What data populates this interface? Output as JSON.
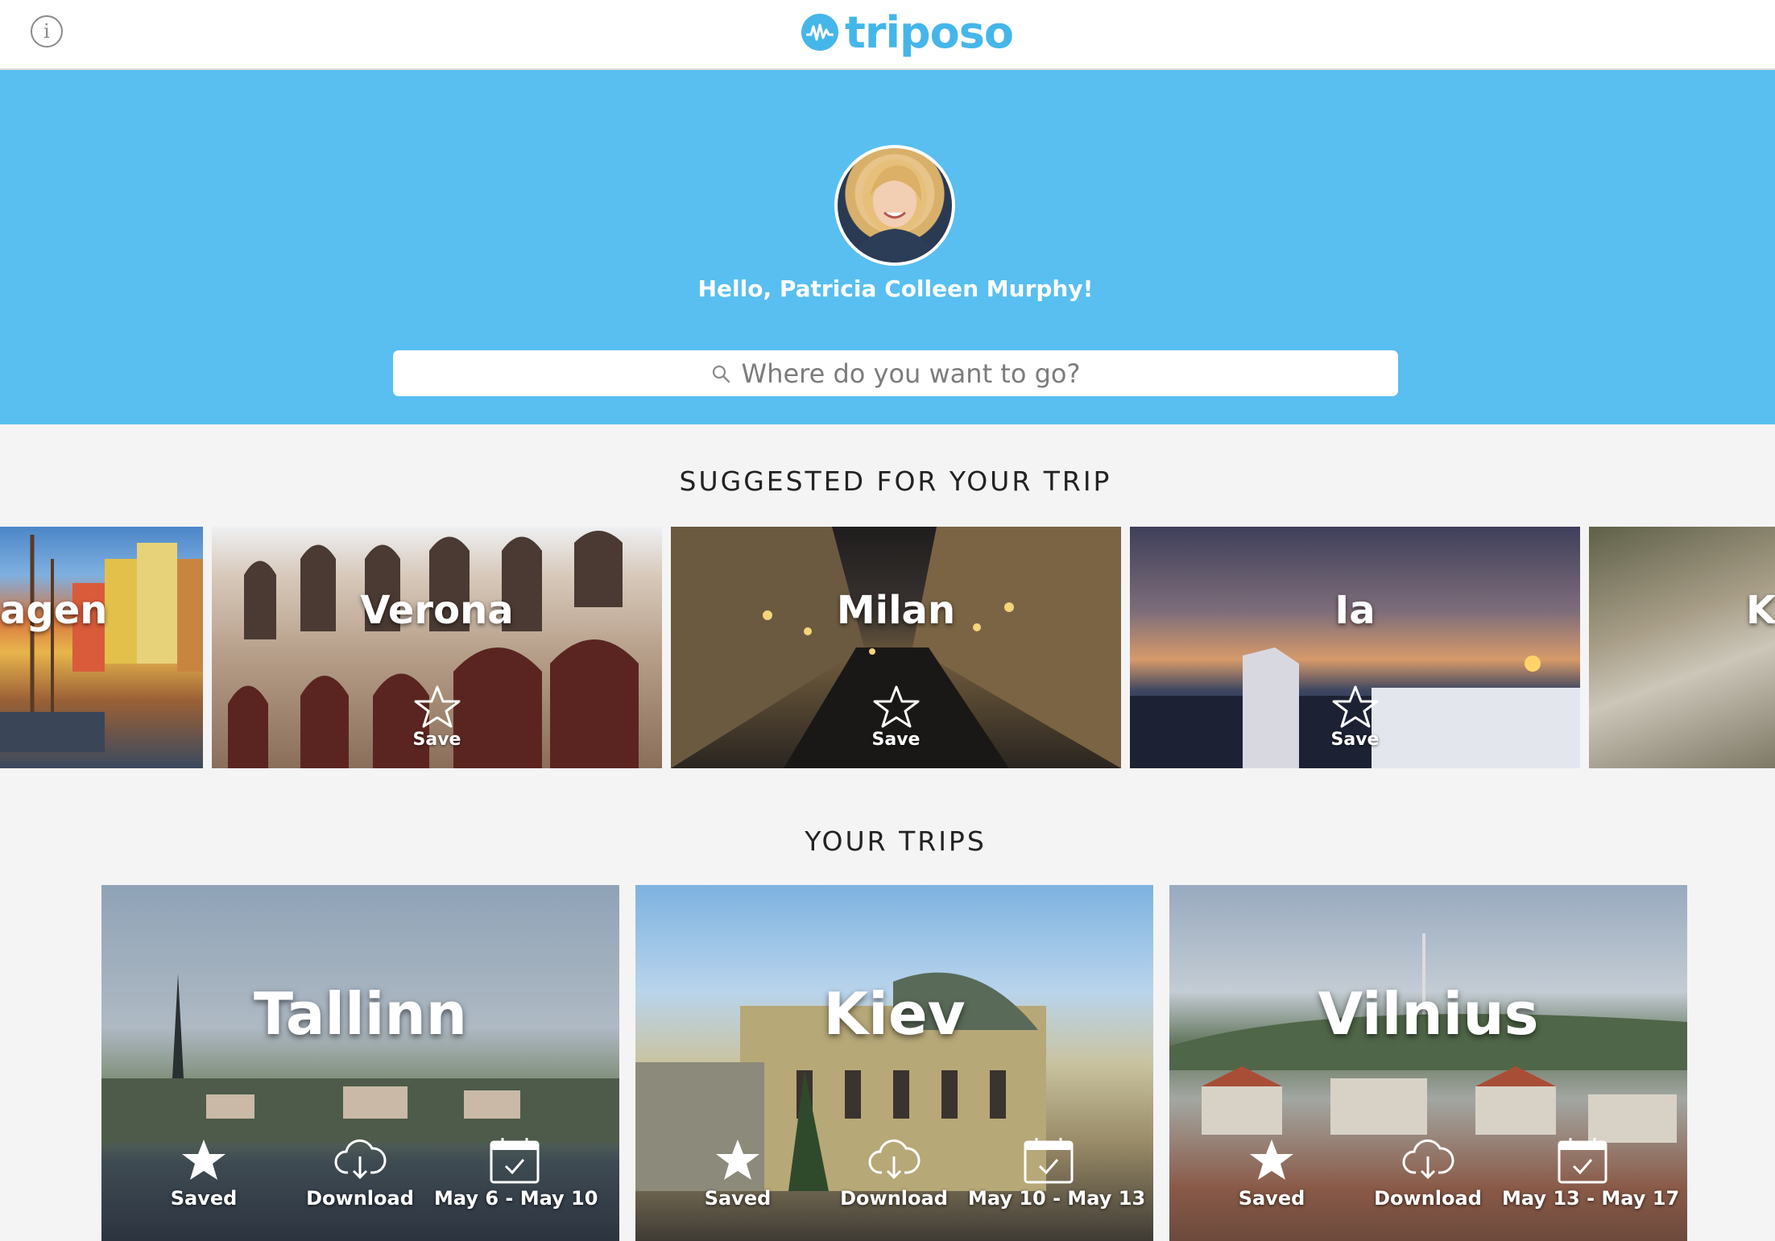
{
  "header": {
    "info_icon": "info-circle-icon",
    "logo_text": "triposo"
  },
  "hero": {
    "greeting": "Hello, Patricia Colleen Murphy!",
    "search_placeholder": "Where do you want to go?",
    "bg_color": "#58bff0"
  },
  "suggested": {
    "title": "SUGGESTED FOR YOUR TRIP",
    "items": [
      {
        "name": "agen",
        "save_label": ""
      },
      {
        "name": "Verona",
        "save_label": "Save"
      },
      {
        "name": "Milan",
        "save_label": "Save"
      },
      {
        "name": "Ia",
        "save_label": "Save"
      },
      {
        "name": "K",
        "save_label": ""
      }
    ]
  },
  "trips": {
    "title": "YOUR TRIPS",
    "items": [
      {
        "name": "Tallinn",
        "saved_label": "Saved",
        "download_label": "Download",
        "dates": "May 6 - May 10"
      },
      {
        "name": "Kiev",
        "saved_label": "Saved",
        "download_label": "Download",
        "dates": "May 10 - May 13"
      },
      {
        "name": "Vilnius",
        "saved_label": "Saved",
        "download_label": "Download",
        "dates": "May 13 - May 17"
      }
    ]
  },
  "colors": {
    "accent": "#45b6ea",
    "hero": "#58bff0",
    "background": "#f4f4f4"
  }
}
